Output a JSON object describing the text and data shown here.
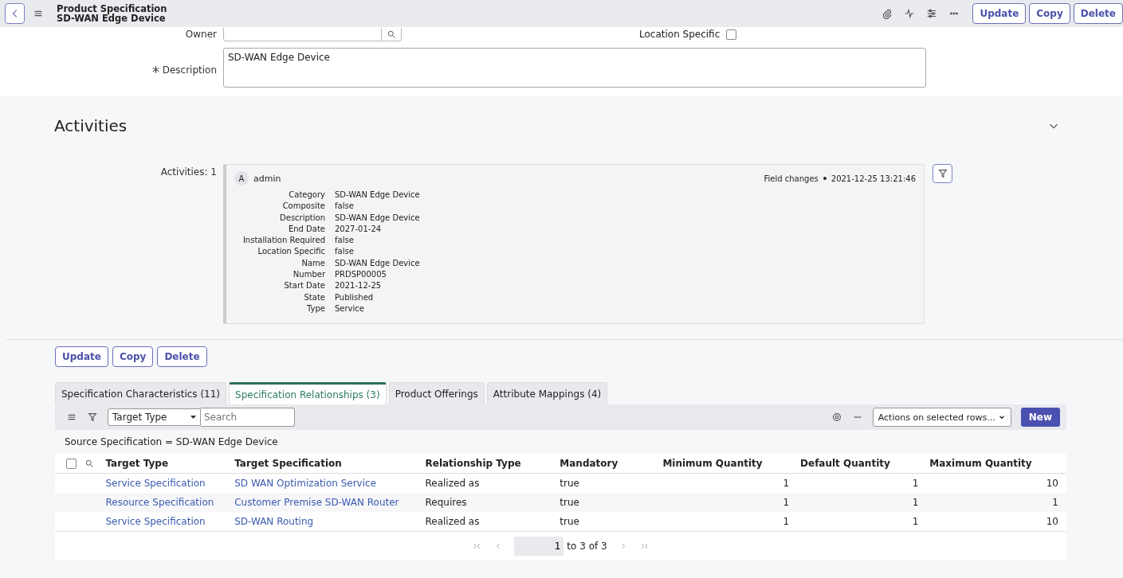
{
  "header": {
    "title": "Product Specification",
    "subtitle": "SD-WAN Edge Device",
    "buttons": [
      "Update",
      "Copy",
      "Delete"
    ]
  },
  "form": {
    "owner_label": "Owner",
    "location_label": "Location Specific",
    "location_checked": false,
    "description_label": "Description",
    "description_required": true,
    "description_value": "SD-WAN Edge Device"
  },
  "activities": {
    "title": "Activities",
    "expanded": true,
    "count_label": "Activities: 1",
    "entry": {
      "avatar": "A",
      "user": "admin",
      "kind_label": "Field changes",
      "time": "2021-12-25 13:21:46",
      "fields": [
        {
          "label": "Category",
          "value": "SD-WAN Edge Device"
        },
        {
          "label": "Composite",
          "value": "false"
        },
        {
          "label": "Description",
          "value": "SD-WAN Edge Device"
        },
        {
          "label": "End Date",
          "value": "2027-01-24"
        },
        {
          "label": "Installation Required",
          "value": "false"
        },
        {
          "label": "Location Specific",
          "value": "false"
        },
        {
          "label": "Name",
          "value": "SD-WAN Edge Device"
        },
        {
          "label": "Number",
          "value": "PRDSP00005"
        },
        {
          "label": "Start Date",
          "value": "2021-12-25"
        },
        {
          "label": "State",
          "value": "Published"
        },
        {
          "label": "Type",
          "value": "Service"
        }
      ]
    }
  },
  "form_buttons": [
    "Update",
    "Copy",
    "Delete"
  ],
  "tabs": [
    {
      "label": "Specification Characteristics (11)",
      "selected": false
    },
    {
      "label": "Specification Relationships (3)",
      "selected": true
    },
    {
      "label": "Product Offerings",
      "selected": false
    },
    {
      "label": "Attribute Mappings (4)",
      "selected": false
    }
  ],
  "list": {
    "select_all_checked": false,
    "search_field": "Target Type",
    "search": {
      "placeholder": "Search"
    },
    "actions": "Actions on selected rows...",
    "new_button": "New",
    "breadcrumb": "Source Specification = SD-WAN Edge Device",
    "columns": [
      "Target Type",
      "Target Specification",
      "Relationship Type",
      "Mandatory",
      "Minimum Quantity",
      "Default Quantity",
      "Maximum Quantity"
    ],
    "rows": [
      [
        "Service Specification",
        "SD WAN Optimization Service",
        "Realized as",
        "true",
        "1",
        "1",
        "10"
      ],
      [
        "Resource Specification",
        "Customer Premise SD-WAN Router",
        "Requires",
        "true",
        "1",
        "1",
        "1"
      ],
      [
        "Service Specification",
        "SD-WAN Routing",
        "Realized as",
        "true",
        "1",
        "1",
        "10"
      ]
    ],
    "pagination": {
      "page": "1",
      "range": "to 3 of 3"
    }
  }
}
